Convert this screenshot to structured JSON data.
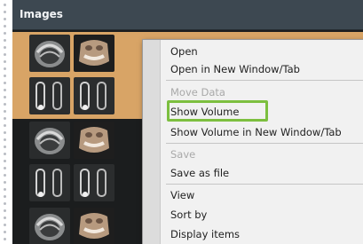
{
  "window": {
    "title": "Images"
  },
  "thumbnails": [
    {
      "row": 1,
      "left": "dental-panoramic-slice",
      "right": "skull-3d-render",
      "selected": true
    },
    {
      "row": 2,
      "left": "tooth-cross-section",
      "right": "tooth-cross-section",
      "selected": true
    },
    {
      "row": 3,
      "left": "dental-panoramic-slice",
      "right": "skull-3d-render",
      "selected": false
    },
    {
      "row": 4,
      "left": "tooth-cross-section",
      "right": "tooth-cross-section",
      "selected": false
    },
    {
      "row": 5,
      "left": "dental-panoramic-slice",
      "right": "skull-3d-render",
      "selected": false
    }
  ],
  "context_menu": {
    "items": [
      {
        "label": "Open",
        "enabled": true
      },
      {
        "label": "Open in New Window/Tab",
        "enabled": true
      },
      {
        "label": "Move Data",
        "enabled": false
      },
      {
        "label": "Show Volume",
        "enabled": true,
        "highlighted": true
      },
      {
        "label": "Show Volume in New Window/Tab",
        "enabled": true
      },
      {
        "label": "Save",
        "enabled": false
      },
      {
        "label": "Save as file",
        "enabled": true
      },
      {
        "label": "View",
        "enabled": true
      },
      {
        "label": "Sort by",
        "enabled": true
      },
      {
        "label": "Display items",
        "enabled": true
      }
    ]
  },
  "colors": {
    "titlebar": "#3d4851",
    "selection": "#d8a466",
    "highlight_border": "#7cbf3f"
  }
}
